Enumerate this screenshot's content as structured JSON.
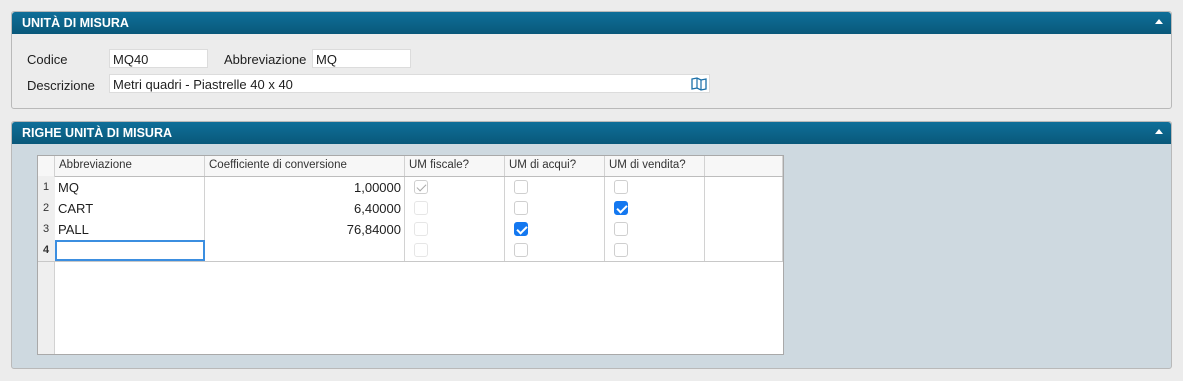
{
  "panel_units": {
    "title": "UNITÀ DI MISURA",
    "code_label": "Codice",
    "code_value": "MQ40",
    "abbr_label": "Abbreviazione",
    "abbr_value": "MQ",
    "desc_label": "Descrizione",
    "desc_value": "Metri quadri - Piastrelle 40 x 40"
  },
  "panel_rows": {
    "title": "RIGHE UNITÀ DI MISURA",
    "columns": [
      "Abbreviazione",
      "Coefficiente di conversione",
      "UM fiscale?",
      "UM di acqui?",
      "UM di vendita?"
    ],
    "rows": [
      {
        "num": "1",
        "abbr": "MQ",
        "coef": "1,00000",
        "fiscale": "checked-disabled",
        "acqui": false,
        "vendita": false
      },
      {
        "num": "2",
        "abbr": "CART",
        "coef": "6,40000",
        "fiscale": "disabled",
        "acqui": false,
        "vendita": true
      },
      {
        "num": "3",
        "abbr": "PALL",
        "coef": "76,84000",
        "fiscale": "disabled",
        "acqui": true,
        "vendita": false
      },
      {
        "num": "4",
        "abbr": "",
        "coef": "",
        "fiscale": "disabled",
        "acqui": false,
        "vendita": false
      }
    ]
  },
  "colors": {
    "header": "#0a5f84",
    "checkbox_on": "#1478f0",
    "panel2_bg": "#ced9e0"
  },
  "icons": {
    "collapse": "chevron-up-icon",
    "lookup": "book-icon"
  }
}
